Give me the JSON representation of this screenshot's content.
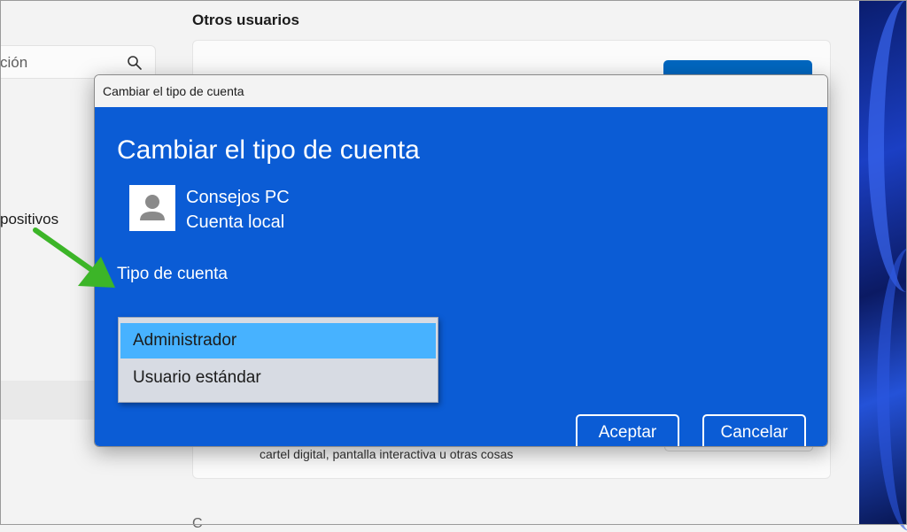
{
  "background": {
    "section_title": "Otros usuarios",
    "search_text": "ción",
    "nav_fragment": "positivos",
    "card_caption": "cartel digital, pantalla interactiva u otras cosas",
    "bottom_fragment": "C"
  },
  "dialog": {
    "window_title": "Cambiar el tipo de cuenta",
    "heading": "Cambiar el tipo de cuenta",
    "user": {
      "name": "Consejos PC",
      "type": "Cuenta local"
    },
    "account_type_label": "Tipo de cuenta",
    "dropdown": {
      "options": [
        {
          "label": "Administrador",
          "selected": true
        },
        {
          "label": "Usuario estándar",
          "selected": false
        }
      ]
    },
    "buttons": {
      "ok": "Aceptar",
      "cancel": "Cancelar"
    }
  },
  "colors": {
    "dialog_body": "#0b5cd5",
    "selected_option": "#47b2ff",
    "annotation_arrow": "#3cb528",
    "accent": "#0067c0"
  },
  "icons": {
    "search": "search-icon",
    "avatar": "user-avatar-icon",
    "annotation": "green-arrow-icon"
  }
}
